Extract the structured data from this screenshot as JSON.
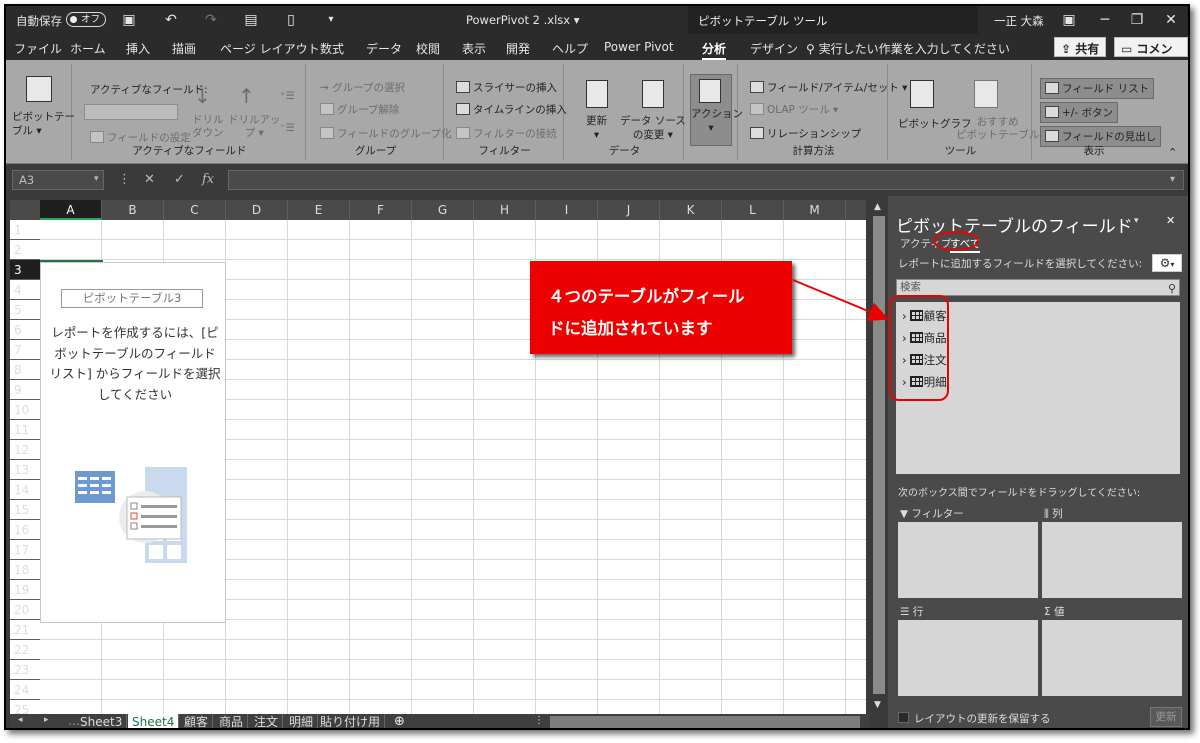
{
  "titlebar": {
    "autosave_label": "自動保存",
    "autosave_state": "オフ",
    "filename": "PowerPivot 2 .xlsx ▾",
    "context_tools": "ピボットテーブル ツール",
    "user": "一正 大森"
  },
  "tabs": [
    "ファイル",
    "ホーム",
    "挿入",
    "描画",
    "ページ レイアウト",
    "数式",
    "データ",
    "校閲",
    "表示",
    "開発",
    "ヘルプ",
    "Power Pivot",
    "分析",
    "デザイン"
  ],
  "tell_me": "実行したい作業を入力してください",
  "share_label": "共有",
  "comment_label": "コメント",
  "ribbon": {
    "pivot_btn": "ピボットテー\nブル ▾",
    "active_field_label": "アクティブなフィールド:",
    "field_settings": "フィールドの設定",
    "drill_down": "ドリル\nダウン",
    "drill_up": "ドリルアッ\nプ ▾",
    "group_active_field": "アクティブなフィールド",
    "group_selection": "→ グループの選択",
    "ungroup": "グループ解除",
    "group_field": "フィールドのグループ化",
    "group_group": "グループ",
    "insert_slicer": "スライサーの挿入",
    "insert_timeline": "タイムラインの挿入",
    "filter_connections": "フィルターの接続",
    "group_filter": "フィルター",
    "refresh": "更新\n▾",
    "change_source": "データ ソース\nの変更 ▾",
    "group_data": "データ",
    "actions": "アクション\n▾",
    "fields_items_sets": "フィールド/アイテム/セット ▾",
    "olap_tools": "OLAP ツール ▾",
    "relationships": "リレーションシップ",
    "group_calc": "計算方法",
    "pivot_chart": "ピボットグラフ",
    "recommended_pivot": "おすすめ\nピボットテーブル",
    "group_tools": "ツール",
    "field_list": "フィールド リスト",
    "plus_minus_buttons": "+/- ボタン",
    "field_headers": "フィールドの見出し",
    "group_show": "表示"
  },
  "namebox": "A3",
  "columns": [
    "A",
    "B",
    "C",
    "D",
    "E",
    "F",
    "G",
    "H",
    "I",
    "J",
    "K",
    "L",
    "M"
  ],
  "rows": [
    "1",
    "2",
    "3",
    "4",
    "5",
    "6",
    "7",
    "8",
    "9",
    "10",
    "11",
    "12",
    "13",
    "14",
    "15",
    "16",
    "17",
    "18",
    "19",
    "20",
    "21",
    "22",
    "23",
    "24",
    "25"
  ],
  "placeholder": {
    "name": "ピボットテーブル3",
    "message": "レポートを作成するには、[ピボットテーブルのフィールド リスト] からフィールドを選択してください"
  },
  "sheet_tabs": [
    "Sheet3",
    "Sheet4",
    "顧客",
    "商品",
    "注文",
    "明細",
    "貼り付け用"
  ],
  "active_sheet": "Sheet4",
  "panel": {
    "title": "ピボットテーブルのフィールド",
    "tab_active": "アクティブ",
    "tab_all": "すべて",
    "subtitle": "レポートに追加するフィールドを選択してください:",
    "search_placeholder": "検索",
    "tables": [
      "顧客",
      "商品",
      "注文",
      "明細"
    ],
    "drag_hint": "次のボックス間でフィールドをドラッグしてください:",
    "area_filter": "フィルター",
    "area_columns": "列",
    "area_rows": "行",
    "area_values": "値",
    "defer_update": "レイアウトの更新を保留する",
    "update_button": "更新"
  },
  "annotation": {
    "line1": "４つのテーブルがフィール",
    "line2": "ドに追加されています"
  },
  "colors": {
    "annotation_red": "#ee0000",
    "excel_green": "#217346"
  }
}
